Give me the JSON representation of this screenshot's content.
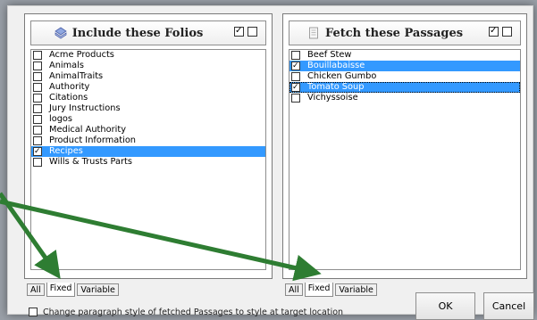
{
  "folios_panel": {
    "title": "Include these Folios",
    "icon": "diamond-stack-icon",
    "items": [
      {
        "label": "Acme Products",
        "checked": false,
        "selected": false
      },
      {
        "label": "Animals",
        "checked": false,
        "selected": false
      },
      {
        "label": "AnimalTraits",
        "checked": false,
        "selected": false
      },
      {
        "label": "Authority",
        "checked": false,
        "selected": false
      },
      {
        "label": "Citations",
        "checked": false,
        "selected": false
      },
      {
        "label": "Jury Instructions",
        "checked": false,
        "selected": false
      },
      {
        "label": "logos",
        "checked": false,
        "selected": false
      },
      {
        "label": "Medical Authority",
        "checked": false,
        "selected": false
      },
      {
        "label": "Product Information",
        "checked": false,
        "selected": false
      },
      {
        "label": "Recipes",
        "checked": true,
        "selected": true
      },
      {
        "label": "Wills & Trusts Parts",
        "checked": false,
        "selected": false
      }
    ],
    "tabs": [
      "All",
      "Fixed",
      "Variable"
    ],
    "active_tab": "Fixed"
  },
  "passages_panel": {
    "title": "Fetch these Passages",
    "icon": "document-icon",
    "items": [
      {
        "label": "Beef Stew",
        "checked": false,
        "selected": false,
        "focused": false
      },
      {
        "label": "Bouillabaisse",
        "checked": true,
        "selected": true,
        "focused": false
      },
      {
        "label": "Chicken Gumbo",
        "checked": false,
        "selected": false,
        "focused": false
      },
      {
        "label": "Tomato Soup",
        "checked": true,
        "selected": true,
        "focused": true
      },
      {
        "label": "Vichyssoise",
        "checked": false,
        "selected": false,
        "focused": false
      }
    ],
    "tabs": [
      "All",
      "Fixed",
      "Variable"
    ],
    "active_tab": "Fixed"
  },
  "buttons": {
    "ok": "OK",
    "cancel": "Cancel"
  },
  "option": {
    "label": "Change paragraph style of fetched Passages to style at target location",
    "checked": false
  },
  "annotation": {
    "arrow_color": "#2e7d32",
    "selection_color": "#3399ff"
  }
}
